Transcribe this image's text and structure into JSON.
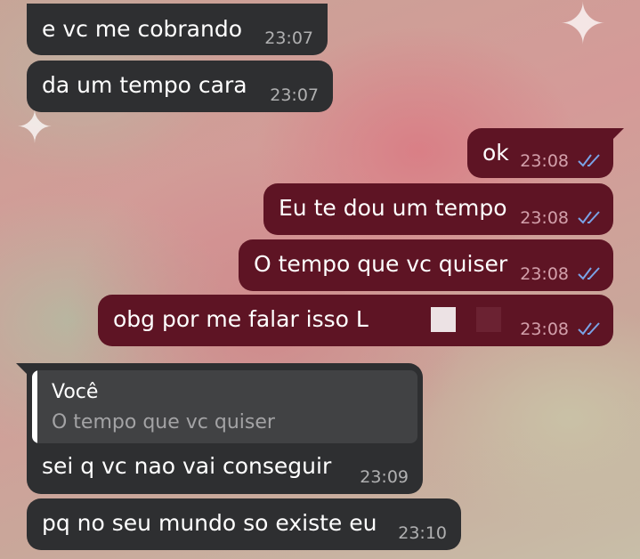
{
  "messages": [
    {
      "text": "e vc me cobrando",
      "time": "23:07"
    },
    {
      "text": "da um tempo cara",
      "time": "23:07"
    },
    {
      "text": "ok",
      "time": "23:08"
    },
    {
      "text": "Eu te dou um tempo",
      "time": "23:08"
    },
    {
      "text": "O tempo que vc quiser",
      "time": "23:08"
    },
    {
      "text": "obg por me falar isso L",
      "time": "23:08"
    },
    {
      "quote_author": "Você",
      "quote_text": "O tempo que vc quiser",
      "text": "sei q vc nao vai conseguir",
      "time": "23:09"
    },
    {
      "text": "pq no seu mundo so existe eu",
      "time": "23:10"
    }
  ],
  "colors": {
    "incoming_bubble": "#2e2f31",
    "outgoing_bubble": "#5e1424",
    "read_checks": "#7aa3e6"
  },
  "icons": [
    "double-check-icon",
    "sparkle-icon"
  ]
}
